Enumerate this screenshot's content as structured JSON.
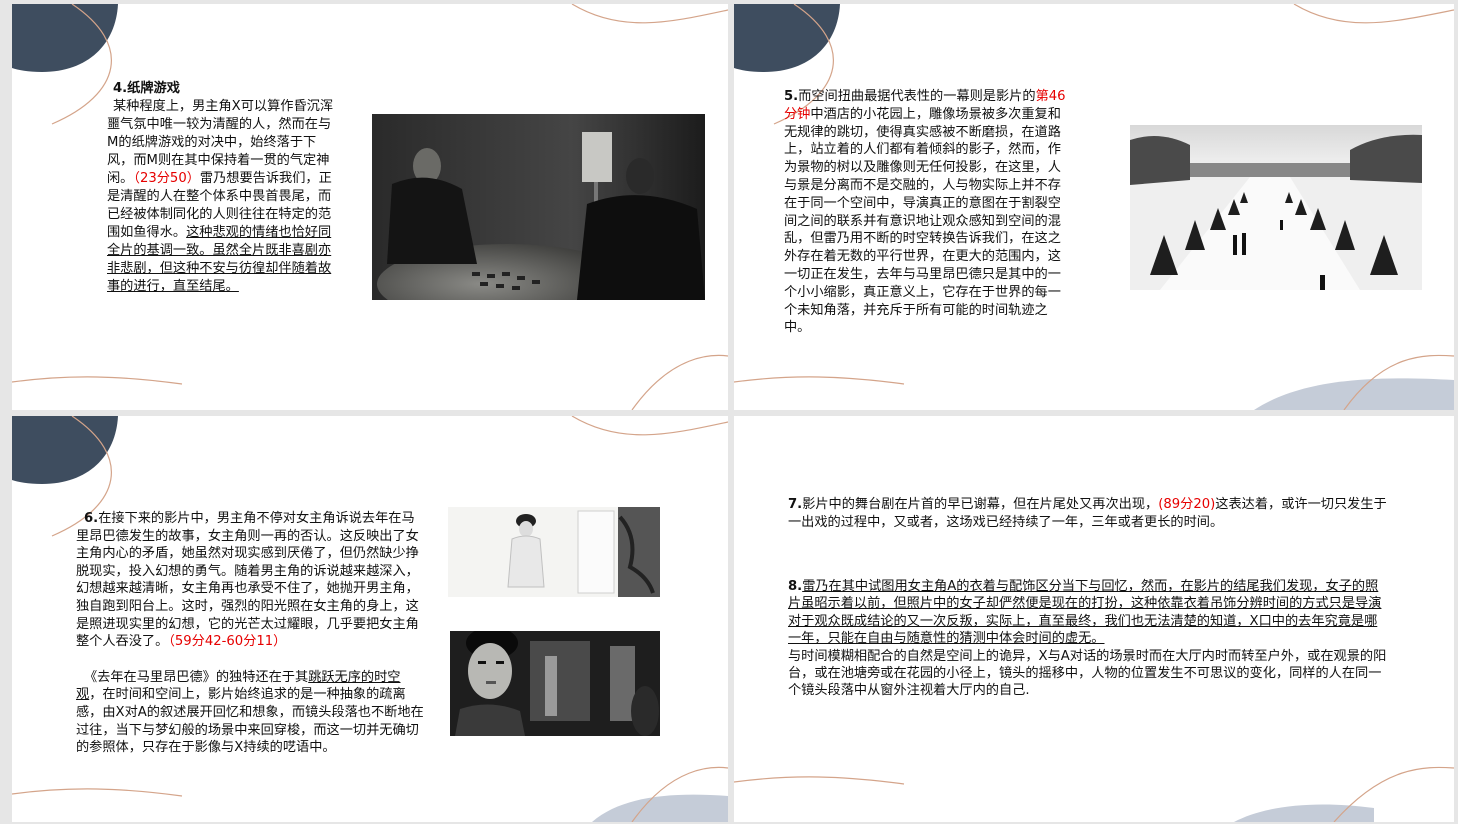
{
  "slides": [
    {
      "heading": "4.纸牌游戏",
      "p1": "某种程度上，男主角X可以算作昏沉浑噩气氛中唯一较为清醒的人，然而在与M的纸牌游戏的对决中，始终落于下风，而M则在其中保持着一贯的气定神闲。",
      "time": "（23分50）",
      "p2": "雷乃想要告诉我们，正是清醒的人在整个体系中畏首畏尾，而已经被体制同化的人则往往在特定的范围如鱼得水。",
      "p2_ul": "这种悲观的情绪也恰好同全片的基调一致。虽然全片既非喜剧亦非悲剧，但这种不安与彷徨却伴随着故事的进行，直至结尾。",
      "image": "card-game-photo"
    },
    {
      "num": "5.",
      "p1": "而空间扭曲最据代表性的一幕则是影片的",
      "time": "第46分钟",
      "p2": "中酒店的小花园上，雕像场景被多次重复和无规律的跳切，使得真实感被不断磨损，在道路上，站立着的人们都有着倾斜的影子，然而，作为景物的树以及雕像则无任何投影，在这里，人与景是分离而不是交融的，人与物实际上并不存在于同一个空间中，导演真正的意图在于割裂空间之间的联系并有意识地让观众感知到空间的混乱，但雷乃用不断的时空转换告诉我们，在这之外存在着无数的平行世界，在更大的范围内，这一切正在发生，去年与马里昂巴德只是其中的一个小小缩影，真正意义上，它存在于世界的每一个未知角落，并充斥于所有可能的时间轨迹之中。",
      "image": "garden-photo"
    },
    {
      "num": "6.",
      "p1": "在接下来的影片中，男主角不停对女主角诉说去年在马里昂巴德发生的故事，女主角则一再的否认。这反映出了女主角内心的矛盾，她虽然对现实感到厌倦了，但仍然缺少挣脱现实，投入幻想的勇气。随着男主角的诉说越来越深入，幻想越来越清晰，女主角再也承受不住了，她抛开男主角，独自跑到阳台上。这时，强烈的阳光照在女主角的身上，这是照进现实里的幻想，它的光芒太过耀眼，几乎要把女主角整个人吞没了。",
      "time": "（59分42-60分11）",
      "p2a": "《去年在马里昂巴德》的独特还在于其",
      "p2_ul": "跳跃无序的时空观",
      "p2b": "，在时间和空间上，影片始终追求的是一种抽象的疏离感，由X对A的叙述展开回忆和想象，而镜头段落也不断地在过往，当下与梦幻般的场景中来回穿梭，而这一切并无确切的参照体，只存在于影像与X持续的呓语中。",
      "image_top": "bright-room-photo",
      "image_bottom": "woman-closeup-photo"
    },
    {
      "num7": "7.",
      "p7a": "影片中的舞台剧在片首的早已谢幕，但在片尾处又再次出现，",
      "time7": "(89分20)",
      "p7b": "这表达着，或许一切只发生于一出戏的过程中，又或者，这场戏已经持续了一年，三年或者更长的时间。",
      "num8": "8.",
      "p8_ul": "雷乃在其中试图用女主角A的衣着与配饰区分当下与回忆，然而，在影片的结尾我们发现，女子的照片虽昭示着以前，但照片中的女子却俨然便是现在的打扮，这种依靠衣着吊饰分辨时间的方式只是导演对于观众既成结论的又一次反叛，实际上，直至最终，我们也无法清楚的知道，X口中的去年究竟是哪一年，只能在自由与随意性的猜测中体会时间的虚无。",
      "p8b": "与时间模糊相配合的自然是空间上的诡异，X与A对话的场景时而在大厅内时而转至户外，或在观景的阳台，或在池塘旁或在花园的小径上，镜头的摇移中，人物的位置发生不可思议的变化，同样的人在同一个镜头段落中从窗外注视着大厅内的自己."
    }
  ],
  "colors": {
    "navy": "#3e4d5f",
    "copper": "#d4a48a",
    "steel": "#c5ccd8",
    "red": "#e60000"
  }
}
